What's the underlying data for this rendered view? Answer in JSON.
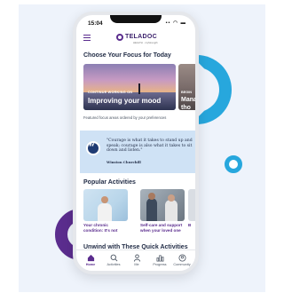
{
  "status_bar": {
    "time": "15:04",
    "icons": "▪▪ ◠ ▬"
  },
  "app_bar": {
    "logo_word": "TELADOC",
    "logo_sub": "HEALTH · myStrength"
  },
  "focus_section": {
    "title": "Choose Your Focus for Today",
    "cards": [
      {
        "eyebrow": "CONTINUE WORKING ON",
        "title": "Improving your mood"
      },
      {
        "eyebrow": "BEGIN",
        "title": "Mana tho"
      }
    ],
    "caption": "Featured focus areas ordered by your preferences"
  },
  "quote": {
    "text": "\"Courage is what it takes to stand up and speak; courage is also what it takes to sit down and listen.\"",
    "author": "Winston Churchill"
  },
  "activities": {
    "title": "Popular Activities",
    "items": [
      {
        "caption": "Your chronic condition: It's not"
      },
      {
        "caption": "Self-care and support when your loved one"
      },
      {
        "caption": "B"
      }
    ]
  },
  "quick_activities": {
    "title": "Unwind with These Quick Activities"
  },
  "bottom_nav": {
    "items": [
      {
        "label": "Home",
        "icon": "home-icon",
        "active": true
      },
      {
        "label": "Activities",
        "icon": "search-icon",
        "active": false
      },
      {
        "label": "Me",
        "icon": "person-icon",
        "active": false
      },
      {
        "label": "Progress",
        "icon": "bar-chart-icon",
        "active": false
      },
      {
        "label": "Community",
        "icon": "community-icon",
        "active": false
      }
    ]
  },
  "colors": {
    "brand_purple": "#5b2d8e",
    "accent_blue": "#27a7dd",
    "quote_bg": "#cfe2f5"
  }
}
